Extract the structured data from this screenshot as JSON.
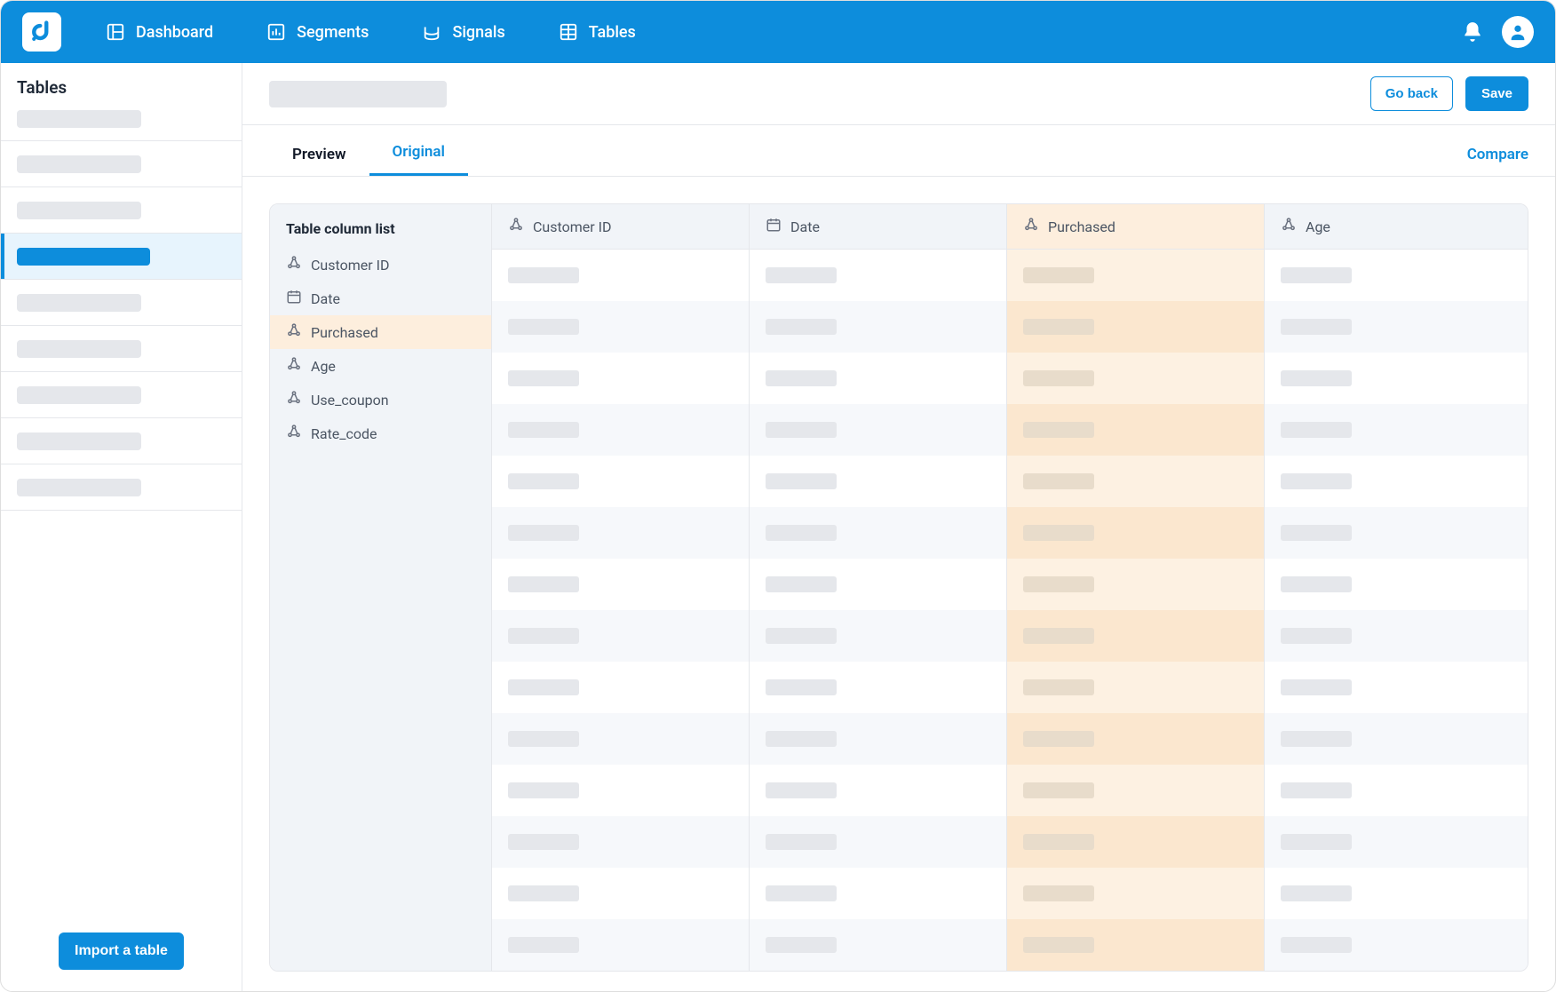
{
  "nav": {
    "dashboard": "Dashboard",
    "segments": "Segments",
    "signals": "Signals",
    "tables": "Tables"
  },
  "sidebar": {
    "title": "Tables",
    "import_btn": "Import a table",
    "items_count": 8,
    "active_index": 2
  },
  "header": {
    "go_back": "Go back",
    "save": "Save"
  },
  "tabs": {
    "preview": "Preview",
    "original": "Original",
    "compare": "Compare",
    "active": "Original"
  },
  "column_list": {
    "title": "Table column list",
    "items": [
      {
        "label": "Customer ID",
        "icon": "cluster",
        "highlight": false
      },
      {
        "label": "Date",
        "icon": "calendar",
        "highlight": false
      },
      {
        "label": "Purchased",
        "icon": "cluster",
        "highlight": true
      },
      {
        "label": "Age",
        "icon": "cluster",
        "highlight": false
      },
      {
        "label": "Use_coupon",
        "icon": "cluster",
        "highlight": false
      },
      {
        "label": "Rate_code",
        "icon": "cluster",
        "highlight": false
      }
    ]
  },
  "table": {
    "columns": [
      {
        "label": "Customer ID",
        "icon": "cluster",
        "highlight": false
      },
      {
        "label": "Date",
        "icon": "calendar",
        "highlight": false
      },
      {
        "label": "Purchased",
        "icon": "cluster",
        "highlight": true
      },
      {
        "label": "Age",
        "icon": "cluster",
        "highlight": false
      }
    ],
    "row_count": 14
  },
  "colors": {
    "brand": "#0d8ddc",
    "highlight": "#fdeedd"
  }
}
